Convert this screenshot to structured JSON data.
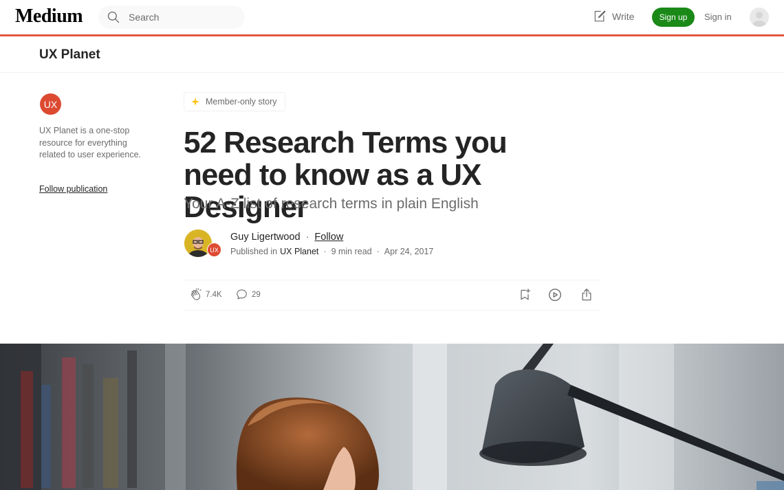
{
  "nav": {
    "logo": "Medium",
    "search_placeholder": "Search",
    "write_label": "Write",
    "signup_label": "Sign up",
    "signin_label": "Sign in"
  },
  "publication": {
    "name": "UX Planet",
    "logo_text": "UX",
    "description": "UX Planet is a one-stop resource for everything related to user experience.",
    "follow_label": "Follow publication"
  },
  "article": {
    "badge": "Member-only story",
    "title": "52 Research Terms you need to know as a UX Designer",
    "subtitle": "Your A-Z list of research terms in plain English",
    "author": "Guy Ligertwood",
    "follow_label": "Follow",
    "published_in_label": "Published in",
    "publication": "UX Planet",
    "read_time": "9 min read",
    "date": "Apr 24, 2017",
    "claps": "7.4K",
    "responses": "29"
  },
  "colors": {
    "accent": "#e2563f",
    "signup_green": "#1a8917",
    "member_star": "#ffc017",
    "pub_logo": "#dd4a32"
  },
  "icons": [
    "search-icon",
    "write-icon",
    "star-icon",
    "clap-icon",
    "comment-icon",
    "bookmark-icon",
    "play-icon",
    "share-icon"
  ]
}
